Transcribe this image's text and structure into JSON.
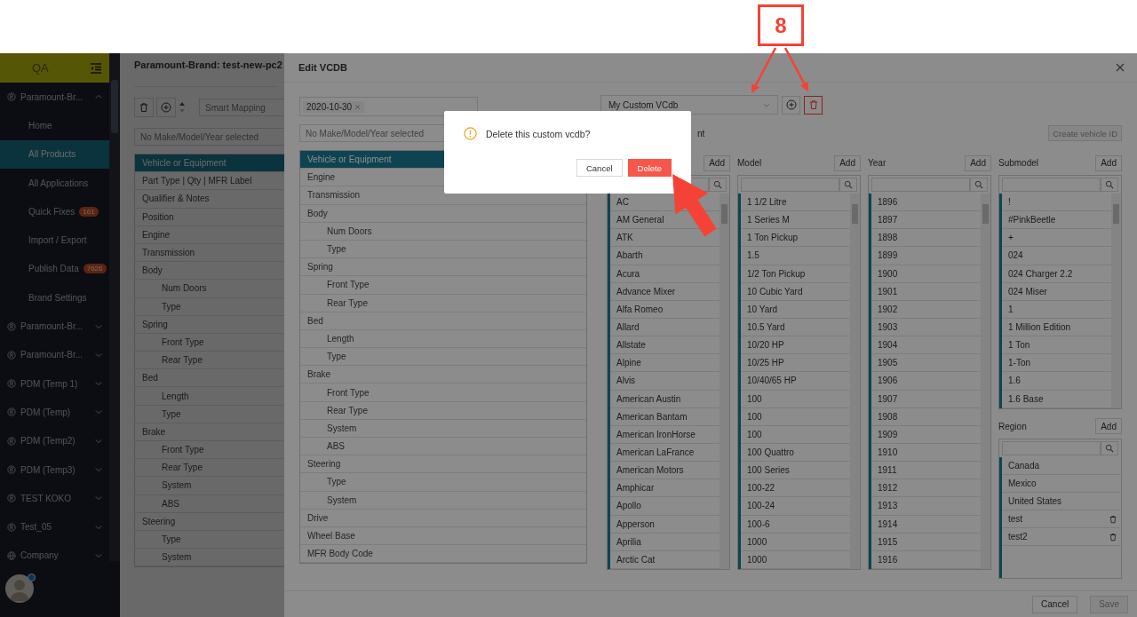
{
  "annotation": {
    "step": "8"
  },
  "sidebar": {
    "header": "QA",
    "groups": [
      {
        "label": "Paramount-Br...",
        "kind": "brand",
        "expanded": true,
        "children": [
          {
            "label": "Home",
            "selected": false
          },
          {
            "label": "All Products",
            "selected": true
          },
          {
            "label": "All Applications",
            "selected": false
          },
          {
            "label": "Quick Fixes",
            "selected": false,
            "badge": "161"
          },
          {
            "label": "Import / Export",
            "selected": false
          },
          {
            "label": "Publish Data",
            "selected": false,
            "badge": "7626"
          },
          {
            "label": "Brand Settings",
            "selected": false
          }
        ]
      },
      {
        "label": "Paramount-Br...",
        "kind": "brand",
        "expanded": false
      },
      {
        "label": "Paramount-Br...",
        "kind": "brand",
        "expanded": false
      },
      {
        "label": "PDM (Temp 1)",
        "kind": "brand",
        "expanded": false
      },
      {
        "label": "PDM (Temp)",
        "kind": "brand",
        "expanded": false
      },
      {
        "label": "PDM (Temp2)",
        "kind": "brand",
        "expanded": false
      },
      {
        "label": "PDM (Temp3)",
        "kind": "brand",
        "expanded": false
      },
      {
        "label": "TEST KOKO",
        "kind": "brand",
        "expanded": false
      },
      {
        "label": "Test_05",
        "kind": "brand",
        "expanded": false
      },
      {
        "label": "Company",
        "kind": "company",
        "expanded": false
      }
    ]
  },
  "page": {
    "title": "Paramount-Brand: test-new-pc2",
    "search_placeholder": "Smart Mapping",
    "filter_placeholder": "No Make/Model/Year selected",
    "categories": [
      {
        "label": "Vehicle or Equipment",
        "selected": true
      },
      {
        "label": "Part Type | Qty | MFR Label",
        "selected": false
      },
      {
        "label": "Qualifier & Notes",
        "selected": false
      },
      {
        "label": "Position",
        "selected": false
      },
      {
        "label": "Engine",
        "selected": false
      },
      {
        "label": "Transmission",
        "selected": false
      },
      {
        "label": "Body",
        "selected": false,
        "children": [
          {
            "label": "Num Doors",
            "selected": false
          },
          {
            "label": "Type",
            "selected": false
          }
        ]
      },
      {
        "label": "Spring",
        "selected": false,
        "children": [
          {
            "label": "Front Type",
            "selected": false
          },
          {
            "label": "Rear Type",
            "selected": false
          }
        ]
      },
      {
        "label": "Bed",
        "selected": false,
        "children": [
          {
            "label": "Length",
            "selected": false
          },
          {
            "label": "Type",
            "selected": false
          }
        ]
      },
      {
        "label": "Brake",
        "selected": false,
        "children": [
          {
            "label": "Front Type",
            "selected": false
          },
          {
            "label": "Rear Type",
            "selected": false
          },
          {
            "label": "System",
            "selected": false
          },
          {
            "label": "ABS",
            "selected": false
          }
        ]
      },
      {
        "label": "Steering",
        "selected": false,
        "children": [
          {
            "label": "Type",
            "selected": false
          },
          {
            "label": "System",
            "selected": false
          }
        ]
      }
    ]
  },
  "drawer": {
    "title": "Edit VCDB",
    "date_tags": [
      "2020-10-30"
    ],
    "filter_placeholder": "No Make/Model/Year selected",
    "categories": [
      {
        "label": "Vehicle or Equipment",
        "selected": true
      },
      {
        "label": "Engine",
        "selected": false
      },
      {
        "label": "Transmission",
        "selected": false
      },
      {
        "label": "Body",
        "selected": false,
        "children": [
          {
            "label": "Num Doors",
            "selected": false
          },
          {
            "label": "Type",
            "selected": false
          }
        ]
      },
      {
        "label": "Spring",
        "selected": false,
        "children": [
          {
            "label": "Front Type",
            "selected": false
          },
          {
            "label": "Rear Type",
            "selected": false
          }
        ]
      },
      {
        "label": "Bed",
        "selected": false,
        "children": [
          {
            "label": "Length",
            "selected": false
          },
          {
            "label": "Type",
            "selected": false
          }
        ]
      },
      {
        "label": "Brake",
        "selected": false,
        "children": [
          {
            "label": "Front Type",
            "selected": false
          },
          {
            "label": "Rear Type",
            "selected": false
          },
          {
            "label": "System",
            "selected": false
          },
          {
            "label": "ABS",
            "selected": false
          }
        ]
      },
      {
        "label": "Steering",
        "selected": false,
        "children": [
          {
            "label": "Type",
            "selected": false
          },
          {
            "label": "System",
            "selected": false
          }
        ]
      },
      {
        "label": "Drive",
        "selected": false
      },
      {
        "label": "Wheel Base",
        "selected": false
      },
      {
        "label": "MFR Body Code",
        "selected": false
      }
    ],
    "vcdb_select": "My Custom VCdb",
    "partial_text": "nt",
    "create_button": {
      "label": "Create vehicle ID",
      "disabled": true
    },
    "columns": [
      {
        "add": "Add",
        "items": [
          "AC",
          "AM General",
          "ATK",
          "Abarth",
          "Acura",
          "Advance Mixer",
          "Alfa Romeo",
          "Allard",
          "Allstate",
          "Alpine",
          "Alvis",
          "American Austin",
          "American Bantam",
          "American IronHorse",
          "American LaFrance",
          "American Motors",
          "Amphicar",
          "Apollo",
          "Apperson",
          "Aprilia",
          "Arctic Cat"
        ]
      },
      {
        "title": "Model",
        "add": "Add",
        "items": [
          "1 1/2 Litre",
          "1 Series M",
          "1 Ton Pickup",
          "1.5",
          "1/2 Ton Pickup",
          "10 Cubic Yard",
          "10 Yard",
          "10.5 Yard",
          "10/20 HP",
          "10/25 HP",
          "10/40/65 HP",
          "100",
          "100",
          "100",
          "100 Quattro",
          "100 Series",
          "100-22",
          "100-24",
          "100-6",
          "1000",
          "1000"
        ]
      },
      {
        "title": "Year",
        "add": "Add",
        "items": [
          "1896",
          "1897",
          "1898",
          "1899",
          "1900",
          "1901",
          "1902",
          "1903",
          "1904",
          "1905",
          "1906",
          "1907",
          "1908",
          "1909",
          "1910",
          "1911",
          "1912",
          "1913",
          "1914",
          "1915",
          "1916"
        ]
      },
      {
        "title": "Submodel",
        "add": "Add",
        "items": [
          "!",
          "#PinkBeetle",
          "+",
          "024",
          "024 Charger 2.2",
          "024 Miser",
          "1",
          "1 Million Edition",
          "1 Ton",
          "1-Ton",
          "1.6",
          "1.6 Base"
        ]
      }
    ],
    "region": {
      "title": "Region",
      "add": "Add",
      "items": [
        {
          "label": "Canada",
          "deletable": false
        },
        {
          "label": "Mexico",
          "deletable": false
        },
        {
          "label": "United States",
          "deletable": false
        },
        {
          "label": "test",
          "deletable": true
        },
        {
          "label": "test2",
          "deletable": true
        }
      ]
    },
    "footer_buttons": [
      {
        "label": "Cancel",
        "disabled": false
      },
      {
        "label": "Save",
        "disabled": true
      }
    ]
  },
  "dialog": {
    "message": "Delete this custom vcdb?",
    "buttons": [
      {
        "label": "Cancel",
        "kind": "default"
      },
      {
        "label": "Delete",
        "kind": "danger"
      }
    ]
  }
}
